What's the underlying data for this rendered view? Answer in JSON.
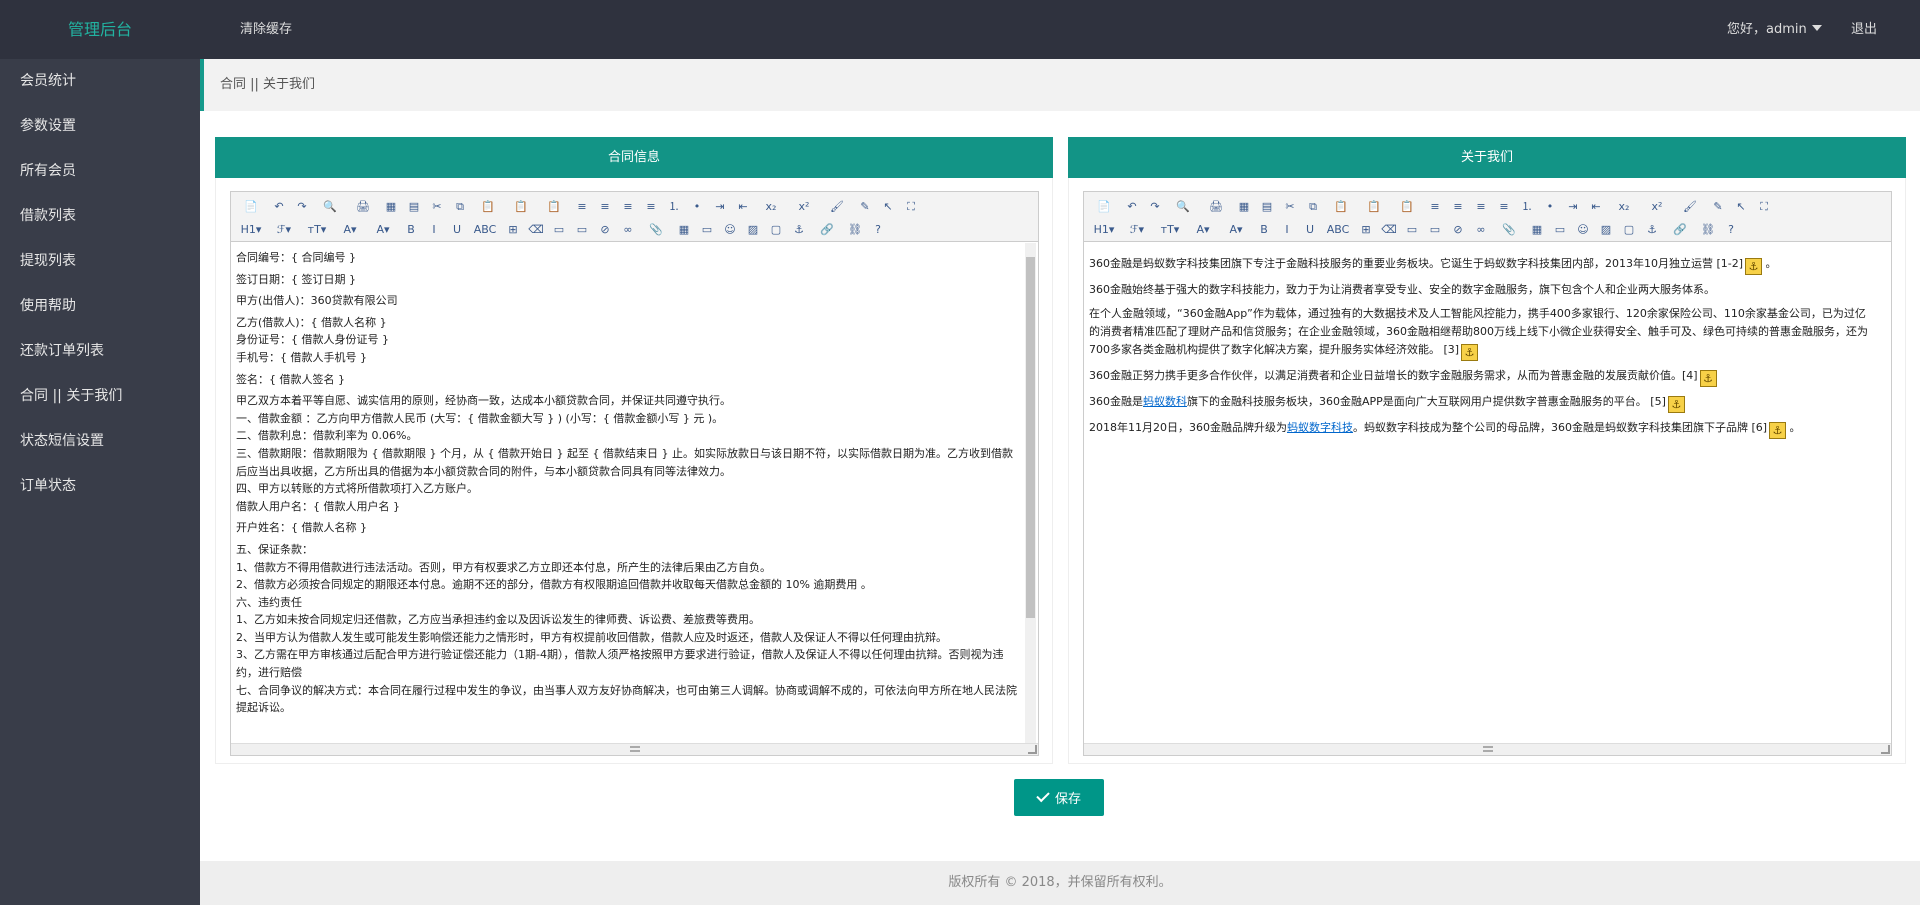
{
  "header": {
    "brand": "管理后台",
    "clear_cache": "清除缓存",
    "greeting": "您好，admin",
    "logout": "退出"
  },
  "sidebar": {
    "items": [
      {
        "label": "会员统计"
      },
      {
        "label": "参数设置"
      },
      {
        "label": "所有会员"
      },
      {
        "label": "借款列表"
      },
      {
        "label": "提现列表"
      },
      {
        "label": "使用帮助"
      },
      {
        "label": "还款订单列表"
      },
      {
        "label": "合同 || 关于我们"
      },
      {
        "label": "状态短信设置"
      },
      {
        "label": "订单状态"
      }
    ]
  },
  "breadcrumb": "合同 || 关于我们",
  "toolbar": {
    "row1": [
      "📄",
      "↶",
      "↷",
      "🔍",
      "🖨",
      "▦",
      "▤",
      "✂",
      "⧉",
      "📋",
      "📋",
      "📋",
      "≡",
      "≡",
      "≡",
      "≡",
      "⒈",
      "•",
      "⇥",
      "⇤",
      "x₂",
      "x²",
      "🖌",
      "✎",
      "↖",
      "⛶"
    ],
    "row2": [
      "H1▾",
      "ℱ▾",
      "тT▾",
      "A▾",
      "A▾",
      "B",
      "I",
      "U",
      "ABC",
      "⊞",
      "⌫",
      "▭",
      "▭",
      "⊘",
      "∞",
      "📎",
      "▦",
      "▭",
      "☺",
      "▨",
      "▢",
      "⚓",
      "🔗",
      "⛓",
      "?"
    ]
  },
  "contract_panel": {
    "title": "合同信息",
    "paragraphs": [
      [
        "合同编号：{ 合同编号 }"
      ],
      [
        "签订日期：{ 签订日期 }"
      ],
      [
        "甲方(出借人)：360贷款有限公司"
      ],
      [
        "乙方(借款人)：{ 借款人名称 }",
        "身份证号：{ 借款人身份证号 }",
        "手机号：{ 借款人手机号 }"
      ],
      [
        "签名：{ 借款人签名 }"
      ],
      [
        "甲乙双方本着平等自愿、诚实信用的原则，经协商一致，达成本小额贷款合同，并保证共同遵守执行。",
        "一、借款金额 ：乙方向甲方借款人民币 (大写：{ 借款金额大写 } ) (小写：{ 借款金额小写 } 元 )。",
        "二、借款利息：借款利率为 0.06%。",
        "三、借款期限：借款期限为 { 借款期限 } 个月，从 { 借款开始日 } 起至 { 借款结束日 } 止。如实际放款日与该日期不符，以实际借款日期为准。乙方收到借款后应当出具收据，乙方所出具的借据为本小额贷款合同的附件，与本小额贷款合同具有同等法律效力。",
        "四、甲方以转账的方式将所借款项打入乙方账户。",
        "借款人用户名：{ 借款人用户名 }"
      ],
      [
        "开户姓名：{ 借款人名称 }"
      ],
      [
        "五、保证条款：",
        "1、借款方不得用借款进行违法活动。否则，甲方有权要求乙方立即还本付息，所产生的法律后果由乙方自负。",
        "2、借款方必须按合同规定的期限还本付息。逾期不还的部分，借款方有权限期追回借款并收取每天借款总金额的 10% 逾期费用 。",
        "六、违约责任",
        "1、乙方如未按合同规定归还借款，乙方应当承担违约金以及因诉讼发生的律师费、诉讼费、差旅费等费用。",
        "2、当甲方认为借款人发生或可能发生影响偿还能力之情形时，甲方有权提前收回借款，借款人应及时返还，借款人及保证人不得以任何理由抗辩。",
        "3、乙方需在甲方审核通过后配合甲方进行验证偿还能力（1期-4期），借款人须严格按照甲方要求进行验证，借款人及保证人不得以任何理由抗辩。否则视为违约，进行赔偿",
        "七、合同争议的解决方式：本合同在履行过程中发生的争议，由当事人双方友好协商解决，也可由第三人调解。协商或调解不成的，可依法向甲方所在地人民法院提起诉讼。"
      ]
    ]
  },
  "about_panel": {
    "title": "关于我们",
    "p1": "360金融是蚂蚁数字科技集团旗下专注于金融科技服务的重要业务板块。它诞生于蚂蚁数字科技集团内部，2013年10月独立运营 [1-2]",
    "p1_end": " 。",
    "p2": "360金融始终基于强大的数字科技能力，致力于为让消费者享受专业、安全的数字金融服务，旗下包含个人和企业两大服务体系。",
    "p3": "在个人金融领域，“360金融App”作为载体，通过独有的大数据技术及人工智能风控能力，携手400多家银行、120余家保险公司、110余家基金公司，已为过亿的消费者精准匹配了理财产品和信贷服务；在企业金融领域，360金融相继帮助800万线上线下小微企业获得安全、触手可及、绿色可持续的普惠金融服务，还为700多家各类金融机构提供了数字化解决方案，提升服务实体经济效能。 [3]",
    "p4": "360金融正努力携手更多合作伙伴，以满足消费者和企业日益增长的数字金融服务需求，从而为普惠金融的发展贡献价值。[4]",
    "p5_a": "360金融是",
    "p5_link": "蚂蚁数科",
    "p5_b": "旗下的金融科技服务板块，360金融APP是面向广大互联网用户提供数字普惠金融服务的平台。 [5]",
    "p6_a": "2018年11月20日，360金融品牌升级为",
    "p6_link": "蚂蚁数字科技",
    "p6_b": "。蚂蚁数字科技成为整个公司的母品牌，360金融是蚂蚁数字科技集团旗下子品牌 [6]",
    "p6_end": " 。",
    "anchor_glyph": "⚓"
  },
  "save_label": "保存",
  "footer": "版权所有 © 2018，并保留所有权利。"
}
